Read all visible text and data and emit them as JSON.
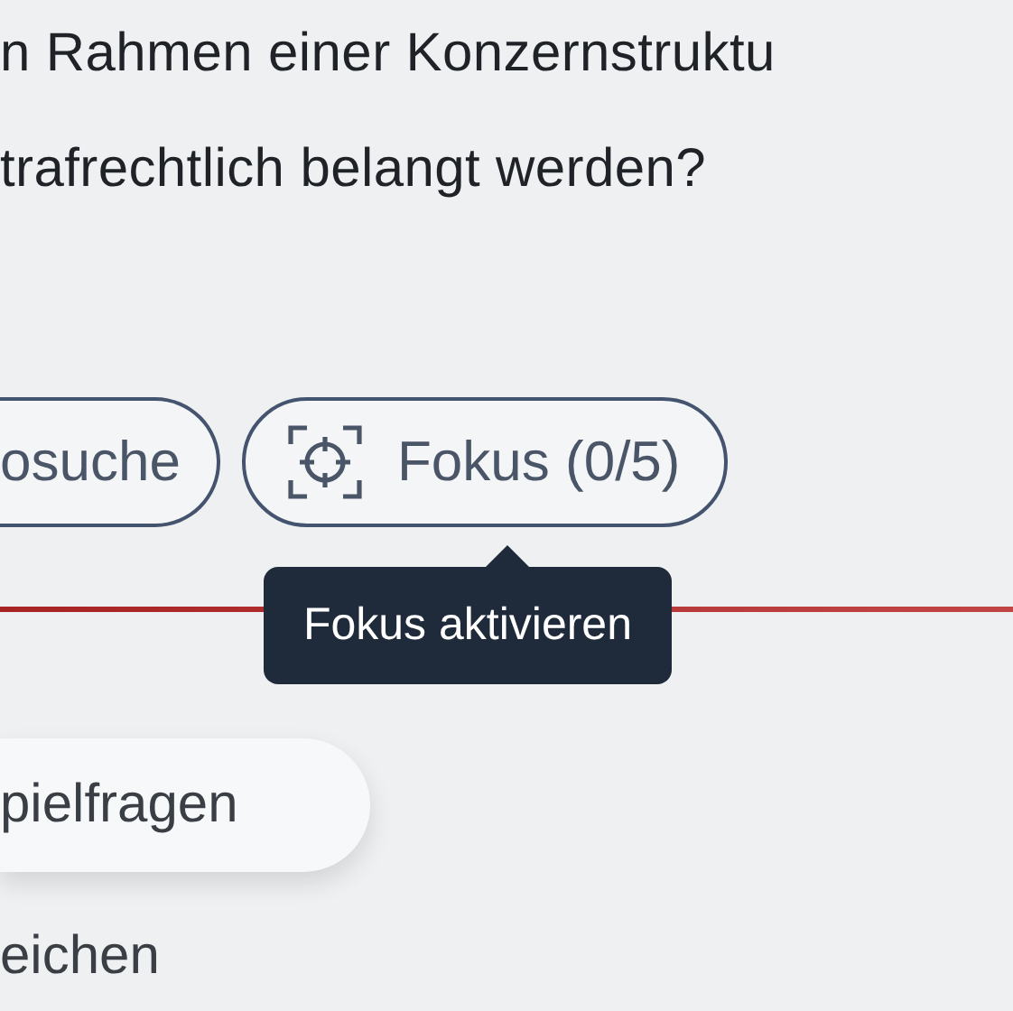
{
  "question": {
    "lines": [
      "n Rahmen einer Konzernstruktu",
      "trafrechtlich belangt werden?"
    ]
  },
  "actions": [
    {
      "label": "osuche",
      "kind": "text"
    },
    {
      "label": "Fokus (0/5)",
      "kind": "focus",
      "tooltip": "Fokus aktivieren"
    }
  ],
  "cards": [
    {
      "label": "pielfragen"
    }
  ],
  "footer_text": "eichen"
}
